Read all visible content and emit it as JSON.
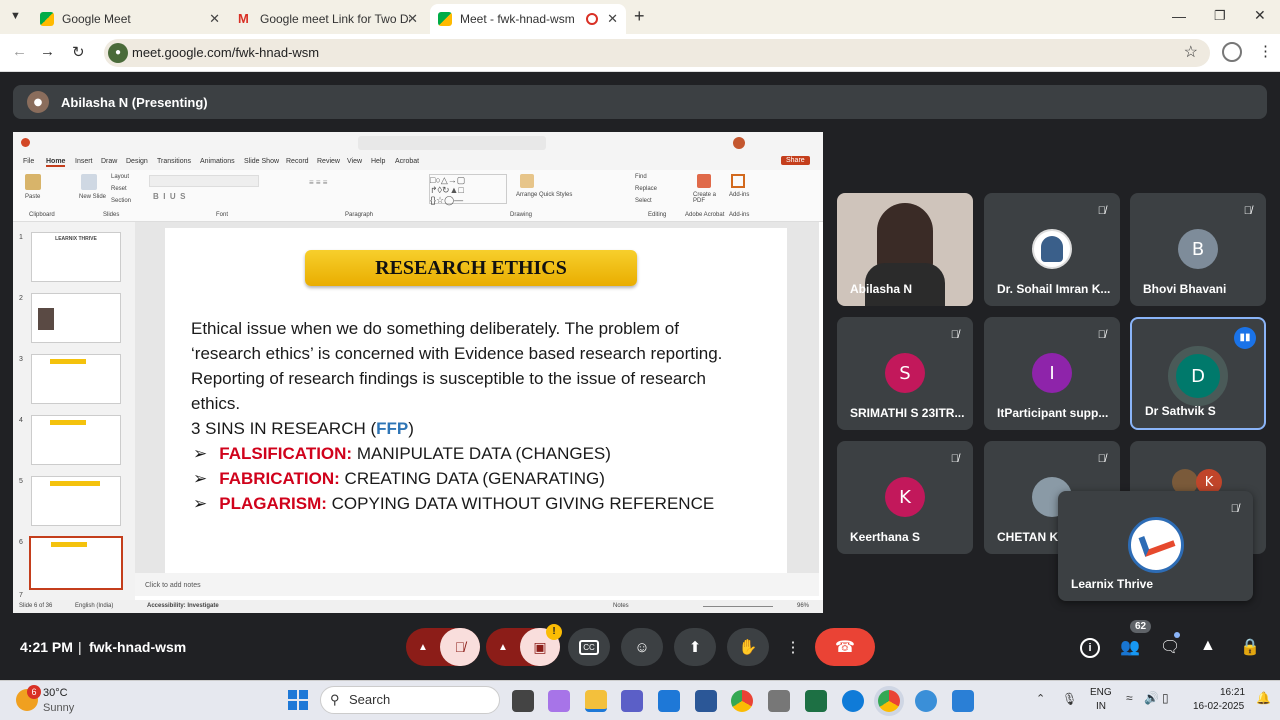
{
  "browser": {
    "tabs": [
      {
        "title": "Google Meet",
        "active": false
      },
      {
        "title": "Google meet Link for Two Days",
        "active": false
      },
      {
        "title": "Meet - fwk-hnad-wsm",
        "active": true
      }
    ],
    "url": "meet.google.com/fwk-hnad-wsm"
  },
  "meet": {
    "presenter_label": "Abilasha N (Presenting)",
    "participants": [
      {
        "name": "Abilasha N",
        "initial": "",
        "color": "#d9cfc7",
        "muted": false
      },
      {
        "name": "Dr. Sohail Imran K...",
        "initial": "",
        "color": "#ffffff",
        "muted": true
      },
      {
        "name": "Bhovi Bhavani",
        "initial": "B",
        "color": "#7e8c9a",
        "muted": true
      },
      {
        "name": "SRIMATHI S 23ITR...",
        "initial": "S",
        "color": "#c2185b",
        "muted": true
      },
      {
        "name": "ItParticipant supp...",
        "initial": "I",
        "color": "#8e24aa",
        "muted": true
      },
      {
        "name": "Dr Sathvik S",
        "initial": "D",
        "color": "#00796b",
        "muted": false
      },
      {
        "name": "Keerthana S",
        "initial": "K",
        "color": "#c2185b",
        "muted": true
      },
      {
        "name": "CHETAN KI",
        "initial": "",
        "color": "#607d8b",
        "muted": true
      },
      {
        "name": "Learnix Thrive",
        "initial": "",
        "color": "#ffffff",
        "muted": true
      }
    ],
    "overflow_badge": "K",
    "time": "4:21 PM",
    "meeting_code": "fwk-hnad-wsm",
    "people_count": "62",
    "alert_badge": "!"
  },
  "ppt": {
    "menu": [
      "File",
      "Home",
      "Insert",
      "Draw",
      "Design",
      "Transitions",
      "Animations",
      "Slide Show",
      "Record",
      "Review",
      "View",
      "Help",
      "Acrobat"
    ],
    "share_label": "Share",
    "groups": [
      "Clipboard",
      "Slides",
      "Font",
      "Paragraph",
      "Drawing",
      "Editing",
      "Adobe Acrobat",
      "Add-ins"
    ],
    "ribbon_buttons": {
      "paste": "Paste",
      "new_slide": "New Slide",
      "layout": "Layout",
      "reset": "Reset",
      "section": "Section",
      "arrange": "Arrange",
      "quick_styles": "Quick Styles",
      "find": "Find",
      "replace": "Replace",
      "select": "Select",
      "create_pdf": "Create a PDF",
      "add_ins": "Add-ins"
    },
    "thumb_numbers": [
      "1",
      "2",
      "3",
      "4",
      "5",
      "6",
      "7"
    ],
    "slide": {
      "title": "RESEARCH ETHICS",
      "para1": "Ethical issue when we do something deliberately. The problem of ‘research ethics’ is concerned with Evidence based research reporting.",
      "para2": "Reporting of research findings is susceptible to the issue of research ethics.",
      "sins_prefix": "3 SINS IN RESEARCH (",
      "sins_highlight": "FFP",
      "sins_suffix": ")",
      "bullets": [
        {
          "term": "FALSIFICATION:",
          "desc": " MANIPULATE DATA (CHANGES)"
        },
        {
          "term": "FABRICATION:",
          "desc": " CREATING DATA (GENARATING)"
        },
        {
          "term": "PLAGARISM:",
          "desc": " COPYING DATA WITHOUT GIVING REFERENCE"
        }
      ]
    },
    "notes_placeholder": "Click to add notes",
    "status": {
      "slide": "Slide 6 of 36",
      "lang": "English (India)",
      "accessibility": "Accessibility: Investigate",
      "notes": "Notes",
      "zoom": "96%"
    }
  },
  "taskbar": {
    "weather_temp": "30°C",
    "weather_desc": "Sunny",
    "weather_badge": "6",
    "search_label": "Search",
    "lang1": "ENG",
    "lang2": "IN",
    "clock_time": "16:21",
    "clock_date": "16-02-2025"
  }
}
